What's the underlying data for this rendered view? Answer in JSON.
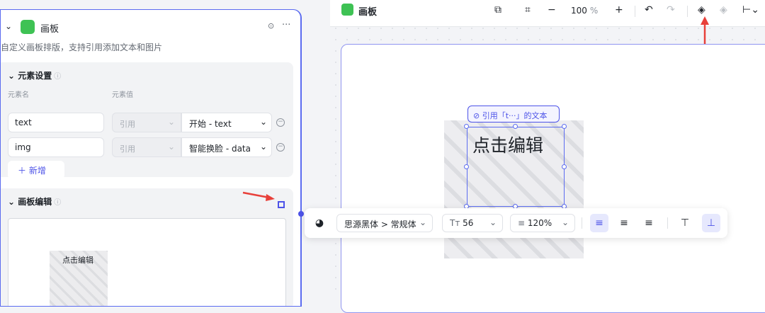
{
  "left_panel": {
    "node_title": "画板",
    "description": "自定义画板排版，支持引用添加文本和图片",
    "element_settings": {
      "title": "元素设置",
      "col_name": "元素名",
      "col_value": "元素值",
      "rows": [
        {
          "name": "text",
          "mode": "引用",
          "value": "开始 - text"
        },
        {
          "name": "img",
          "mode": "引用",
          "value": "智能换脸 - data"
        }
      ],
      "add_label": "新增"
    },
    "canvas_edit": {
      "title": "画板编辑",
      "preview_text": "点击编辑"
    }
  },
  "toolbar": {
    "title": "画板",
    "zoom_value": "100",
    "zoom_unit": "%"
  },
  "canvas": {
    "ref_label": "引用「t···」的文本",
    "text": "点击编辑"
  },
  "format_toolbar": {
    "font": "思源黑体 > 常规体",
    "size": "56",
    "line_height": "120%"
  },
  "colors": {
    "accent": "#4d53e8",
    "node_icon": "#3ec254",
    "annotation_arrow": "#e8403a"
  }
}
